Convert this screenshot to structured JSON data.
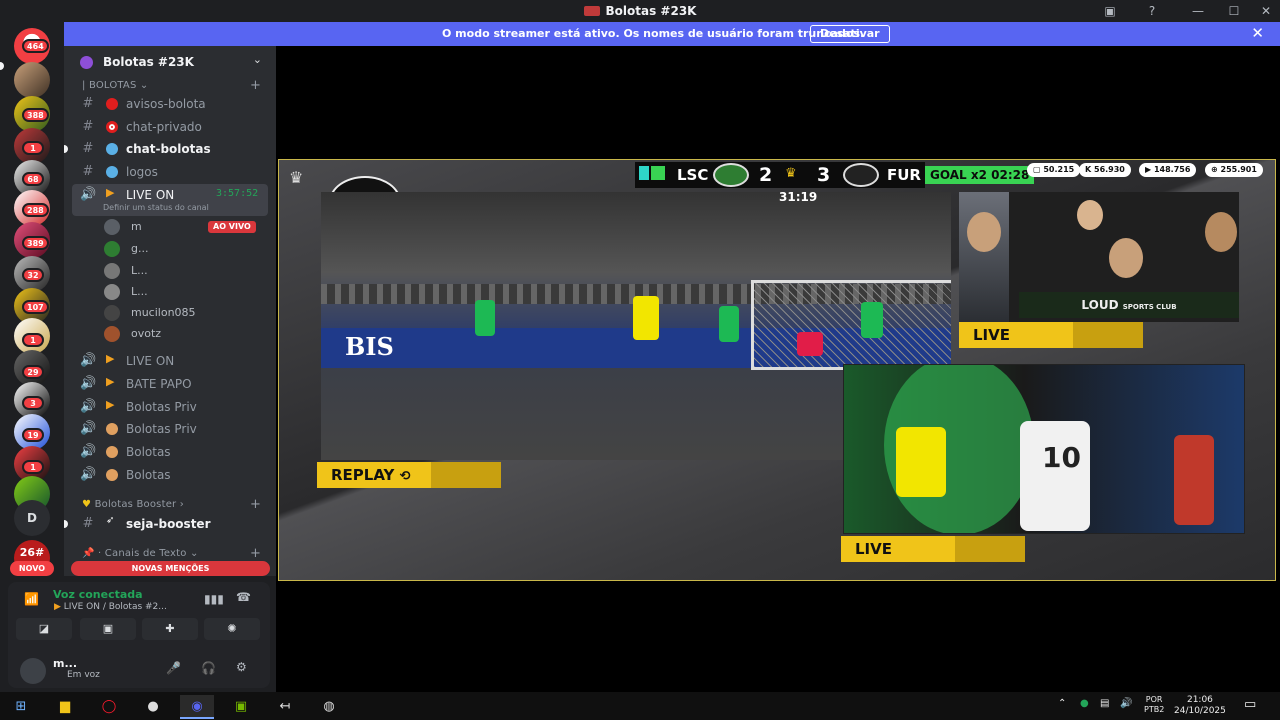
{
  "window": {
    "title": "Bolotas #23K"
  },
  "banner": {
    "message": "O modo streamer está ativo. Os nomes de usuário foram truncados.",
    "button": "Desativar"
  },
  "servers": {
    "badges": [
      "464",
      "388",
      "1",
      "68",
      "288",
      "389",
      "32",
      "107",
      "1",
      "29",
      "3",
      "19",
      "1",
      "1"
    ],
    "novo": "NOVO",
    "letter_server": "D",
    "bottom_label": "26#"
  },
  "guild": {
    "name": "Bolotas #23K"
  },
  "categories": {
    "bolotas": "| BOLOTAS",
    "booster": "Bolotas Booster",
    "texto": "· Canais de Texto"
  },
  "channels": [
    {
      "name": "avisos-bolota"
    },
    {
      "name": "chat-privado"
    },
    {
      "name": "chat-bolotas"
    },
    {
      "name": "logos"
    }
  ],
  "live_channel": {
    "name": "LIVE ON",
    "timer": "3:57:52",
    "status": "Definir um status do canal"
  },
  "ao_vivo": "AO VIVO",
  "voice_users": [
    "m",
    "g...",
    "L...",
    "L...",
    "mucilon085",
    "ovotz"
  ],
  "voice_channels": [
    "LIVE ON",
    "BATE PAPO",
    "Bolotas Priv",
    "Bolotas Priv",
    "Bolotas",
    "Bolotas"
  ],
  "booster_channel": {
    "name": "seja-booster"
  },
  "novas_mencoes": "NOVAS MENÇÕES",
  "voice_panel": {
    "title": "Voz conectada",
    "subtitle": "LIVE ON / Bolotas #2..."
  },
  "user": {
    "name": "m...",
    "status": "Em voz"
  },
  "stream": {
    "team_home": "LSC",
    "score_home": "2",
    "score_away": "3",
    "team_away": "FUR",
    "goal": "GOAL x2",
    "goal_time": "02:28",
    "match_clock": "31:19",
    "stats": [
      "50.215",
      "56.930",
      "148.756",
      "255.901"
    ],
    "brand": "LOUD",
    "brand_sub": "SPORTS CLUB",
    "replay_label": "REPLAY",
    "live_label_top": "LIVE",
    "live_label_bottom": "LIVE",
    "ad_text": "BIS",
    "jersey_number": "10"
  },
  "taskbar": {
    "lang_top": "POR",
    "lang_bottom": "PTB2",
    "time": "21:06",
    "date": "24/10/2025"
  },
  "colors": {
    "accent": "#5865f2",
    "danger": "#f23f43",
    "online": "#23a559",
    "overlay_yellow": "#f0c419",
    "goal_green": "#39d353"
  }
}
